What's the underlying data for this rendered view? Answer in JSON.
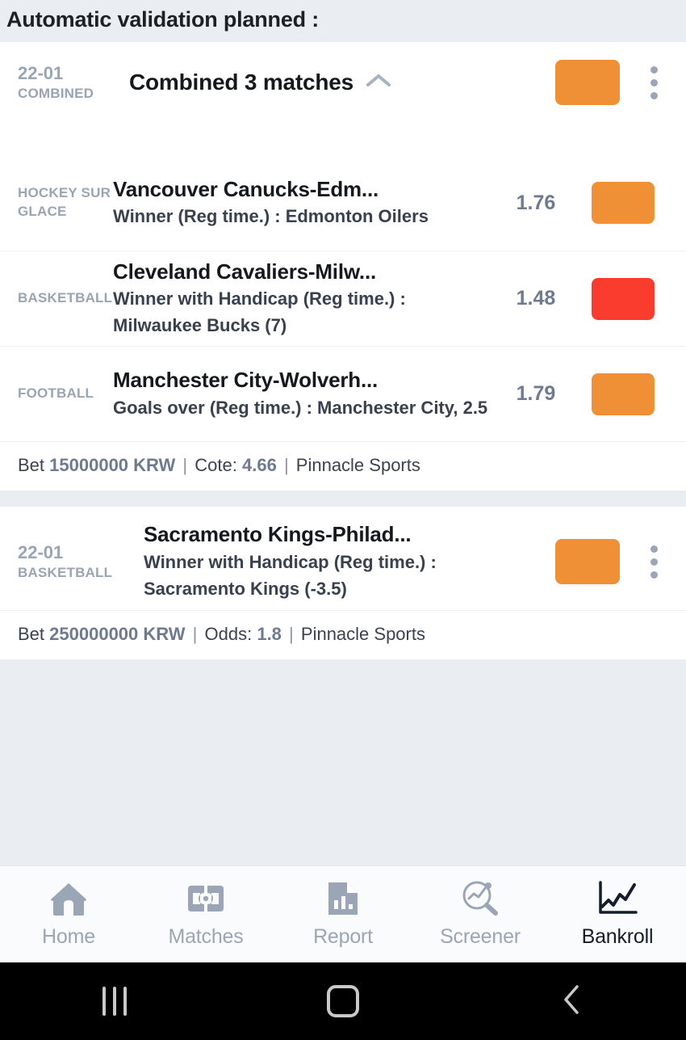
{
  "header": {
    "title": "Automatic validation planned :"
  },
  "combined_card": {
    "date": "22-01",
    "type_label": "COMBINED",
    "title": "Combined 3 matches",
    "collapse_icon": "chevron-up-icon",
    "status_color": "#ef9036",
    "menu_icon": "kebab-menu-icon",
    "matches": [
      {
        "sport": "HOCKEY SUR GLACE",
        "title": "Vancouver Canucks-Edm...",
        "selection": "Winner (Reg time.) : Edmonton Oilers",
        "odds": "1.76",
        "status_color": "#ef9036"
      },
      {
        "sport": "BASKETBALL",
        "title": "Cleveland Cavaliers-Milw...",
        "selection": "Winner with Handicap (Reg time.) : Milwaukee Bucks (7)",
        "odds": "1.48",
        "status_color": "#f93c2e"
      },
      {
        "sport": "FOOTBALL",
        "title": "Manchester City-Wolverh...",
        "selection": "Goals over (Reg time.) : Manchester City, 2.5",
        "odds": "1.79",
        "status_color": "#ef9036"
      }
    ],
    "footer": {
      "bet_label": "Bet",
      "bet_amount": "15000000 KRW",
      "odds_label": "Cote:",
      "odds_value": "4.66",
      "bookmaker": "Pinnacle Sports",
      "separator": "|"
    }
  },
  "single_card": {
    "date": "22-01",
    "sport": "BASKETBALL",
    "title": "Sacramento Kings-Philad...",
    "selection": "Winner with Handicap (Reg time.) : Sacramento Kings (-3.5)",
    "status_color": "#ef9036",
    "menu_icon": "kebab-menu-icon",
    "footer": {
      "bet_label": "Bet",
      "bet_amount": "250000000 KRW",
      "odds_label": "Odds:",
      "odds_value": "1.8",
      "bookmaker": "Pinnacle Sports",
      "separator": "|"
    }
  },
  "tabbar": {
    "tabs": [
      {
        "label": "Home",
        "icon": "home-icon",
        "active": false
      },
      {
        "label": "Matches",
        "icon": "pitch-icon",
        "active": false
      },
      {
        "label": "Report",
        "icon": "report-document-icon",
        "active": false
      },
      {
        "label": "Screener",
        "icon": "screener-search-icon",
        "active": false
      },
      {
        "label": "Bankroll",
        "icon": "line-chart-icon",
        "active": true
      }
    ],
    "inactive_color": "#9aa5b5",
    "active_color": "#151d2c"
  },
  "android_nav": {
    "recents_icon": "recent-apps-icon",
    "home_icon": "android-home-icon",
    "back_icon": "android-back-icon"
  }
}
